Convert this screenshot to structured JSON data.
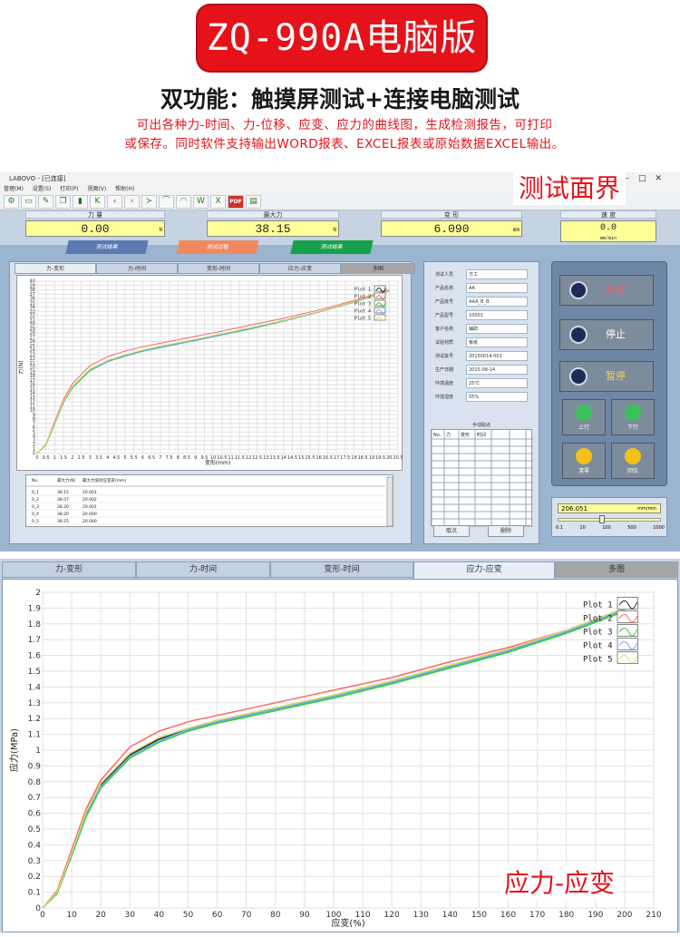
{
  "header": {
    "title": "ZQ-990A电脑版",
    "subtitle": "双功能：触摸屏测试+连接电脑测试",
    "description_line1": "可出各种力-时间、力-位移、应变、应力的曲线图，生成检测报告，可打印",
    "description_line2": "或保存。同时软件支持输出WORD报表、EXCEL报表或原始数据EXCEL输出。",
    "label_interface": "测试面界",
    "label_stress_strain": "应力-应变"
  },
  "window": {
    "title": "LABOVO - [已连接]",
    "menu": [
      "管理(M)",
      "设置(S)",
      "打印(P)",
      "视图(V)",
      "帮助(H)"
    ],
    "toolbar_pdf": "PDF",
    "readouts": [
      {
        "label": "力  量",
        "value": "0.00",
        "unit": "N"
      },
      {
        "label": "最大力",
        "value": "38.15",
        "unit": "N"
      },
      {
        "label": "变  形",
        "value": "6.090",
        "unit": "mm"
      },
      {
        "label": "速  度",
        "value": "0.0",
        "unit": "mm/min"
      }
    ],
    "big_tabs": [
      "测试结果",
      "测试过程",
      "测试结果"
    ],
    "panel_tabs": [
      "力-变形",
      "力-时间",
      "变形-时间",
      "应力-应变",
      "多图"
    ],
    "mini_chart": {
      "xlabel": "变形(mm)",
      "ylabel": "力(N)"
    },
    "mini_table": {
      "headers": [
        "No.",
        "最大力(N)",
        "最大力值对应变形(mm)"
      ],
      "rows": [
        [
          "0_1",
          "38.15",
          "20.001"
        ],
        [
          "0_2",
          "38.07",
          "20.002"
        ],
        [
          "0_3",
          "38.20",
          "20.001"
        ],
        [
          "0_4",
          "38.20",
          "20.000"
        ],
        [
          "0_5",
          "38.25",
          "20.000"
        ]
      ]
    },
    "info_fields": [
      {
        "label": "测试人员",
        "value": "方工"
      },
      {
        "label": "产品名称",
        "value": "AA"
      },
      {
        "label": "产品批号",
        "value": "AAA_B_B"
      },
      {
        "label": "产品型号",
        "value": "10001"
      },
      {
        "label": "客户名称",
        "value": "辅助"
      },
      {
        "label": "试验材质",
        "value": "板纸"
      },
      {
        "label": "测试批号",
        "value": "20150014-001"
      },
      {
        "label": "生产日期",
        "value": "2015-08-14"
      },
      {
        "label": "环境温度",
        "value": "25℃"
      },
      {
        "label": "环境湿度",
        "value": "55%"
      }
    ],
    "manual_points": {
      "caption": "手动取点",
      "headers": [
        "No.",
        "力",
        "变形",
        "时间"
      ],
      "btn_pick": "取点",
      "btn_delete": "删除"
    },
    "controls": {
      "test": "测试",
      "stop": "停止",
      "pause": "暂停",
      "up": "上行",
      "down": "下行",
      "clear": "清零",
      "return": "回位"
    },
    "speed": {
      "value": "206.051",
      "unit": "mm/min",
      "scale": [
        "0.1",
        "10",
        "100",
        "500",
        "1000"
      ]
    }
  },
  "bottom": {
    "tabs": [
      "力-变形",
      "力-时间",
      "变形-时间",
      "应力-应变",
      "多图"
    ],
    "active_tab": 3
  },
  "chart_data": [
    {
      "type": "line",
      "title": "",
      "xlabel": "变形(mm)",
      "ylabel": "力(N)",
      "xlim": [
        0,
        20.5
      ],
      "ylim": [
        0,
        40
      ],
      "legend": "top-right",
      "grid": true,
      "x": [
        0,
        0.5,
        1,
        1.5,
        2,
        3,
        4,
        5,
        6,
        7,
        8,
        9,
        10,
        12,
        14,
        16,
        18,
        20
      ],
      "series": [
        {
          "name": "Plot 1",
          "color": "#222222",
          "values": [
            0,
            2,
            7,
            12,
            15.5,
            19.5,
            21.5,
            22.8,
            23.9,
            24.8,
            25.6,
            26.4,
            27.3,
            29.0,
            30.9,
            32.9,
            35.2,
            37.8
          ]
        },
        {
          "name": "Plot 2",
          "color": "#ff6666",
          "values": [
            0,
            2.2,
            7.5,
            12.6,
            16.2,
            20.4,
            22.5,
            23.8,
            24.8,
            25.6,
            26.4,
            27.2,
            28.0,
            29.7,
            31.4,
            33.3,
            35.5,
            38.0
          ]
        },
        {
          "name": "Plot 3",
          "color": "#33cc33",
          "values": [
            0,
            1.9,
            6.8,
            11.8,
            15.2,
            19.2,
            21.3,
            22.6,
            23.7,
            24.6,
            25.4,
            26.2,
            27.1,
            28.8,
            30.7,
            32.8,
            35.1,
            37.7
          ]
        },
        {
          "name": "Plot 4",
          "color": "#66aaff",
          "values": [
            0,
            2,
            7,
            12,
            15.4,
            19.4,
            21.4,
            22.7,
            23.8,
            24.7,
            25.5,
            26.3,
            27.2,
            28.9,
            30.8,
            32.8,
            35.2,
            37.8
          ]
        },
        {
          "name": "Plot 5",
          "color": "#dddd66",
          "values": [
            0,
            2,
            7.1,
            12.1,
            15.6,
            19.6,
            21.6,
            22.9,
            24.0,
            24.9,
            25.7,
            26.5,
            27.4,
            29.1,
            30.9,
            32.9,
            35.2,
            37.9
          ]
        }
      ]
    },
    {
      "type": "line",
      "title": "",
      "xlabel": "应变(%)",
      "ylabel": "应力(MPa)",
      "xlim": [
        0,
        210
      ],
      "ylim": [
        0,
        2
      ],
      "legend": "top-right",
      "grid": true,
      "x": [
        0,
        5,
        10,
        15,
        20,
        30,
        40,
        50,
        60,
        70,
        80,
        90,
        100,
        120,
        140,
        160,
        180,
        200
      ],
      "series": [
        {
          "name": "Plot 1",
          "color": "#222222",
          "values": [
            0,
            0.1,
            0.35,
            0.6,
            0.78,
            0.97,
            1.07,
            1.13,
            1.18,
            1.22,
            1.26,
            1.3,
            1.34,
            1.43,
            1.53,
            1.63,
            1.75,
            1.89
          ]
        },
        {
          "name": "Plot 2",
          "color": "#ff6666",
          "values": [
            0,
            0.11,
            0.37,
            0.63,
            0.81,
            1.02,
            1.12,
            1.18,
            1.22,
            1.26,
            1.3,
            1.34,
            1.38,
            1.46,
            1.56,
            1.65,
            1.76,
            1.9
          ]
        },
        {
          "name": "Plot 3",
          "color": "#33cc33",
          "values": [
            0,
            0.09,
            0.33,
            0.58,
            0.76,
            0.95,
            1.05,
            1.12,
            1.17,
            1.21,
            1.25,
            1.29,
            1.33,
            1.42,
            1.52,
            1.62,
            1.74,
            1.88
          ]
        },
        {
          "name": "Plot 4",
          "color": "#66aaff",
          "values": [
            0,
            0.1,
            0.34,
            0.6,
            0.77,
            0.96,
            1.06,
            1.13,
            1.18,
            1.22,
            1.26,
            1.3,
            1.34,
            1.43,
            1.53,
            1.63,
            1.75,
            1.89
          ]
        },
        {
          "name": "Plot 5",
          "color": "#dddd66",
          "values": [
            0,
            0.1,
            0.35,
            0.61,
            0.79,
            0.98,
            1.08,
            1.14,
            1.19,
            1.23,
            1.27,
            1.31,
            1.35,
            1.44,
            1.54,
            1.64,
            1.76,
            1.9
          ]
        }
      ]
    }
  ]
}
